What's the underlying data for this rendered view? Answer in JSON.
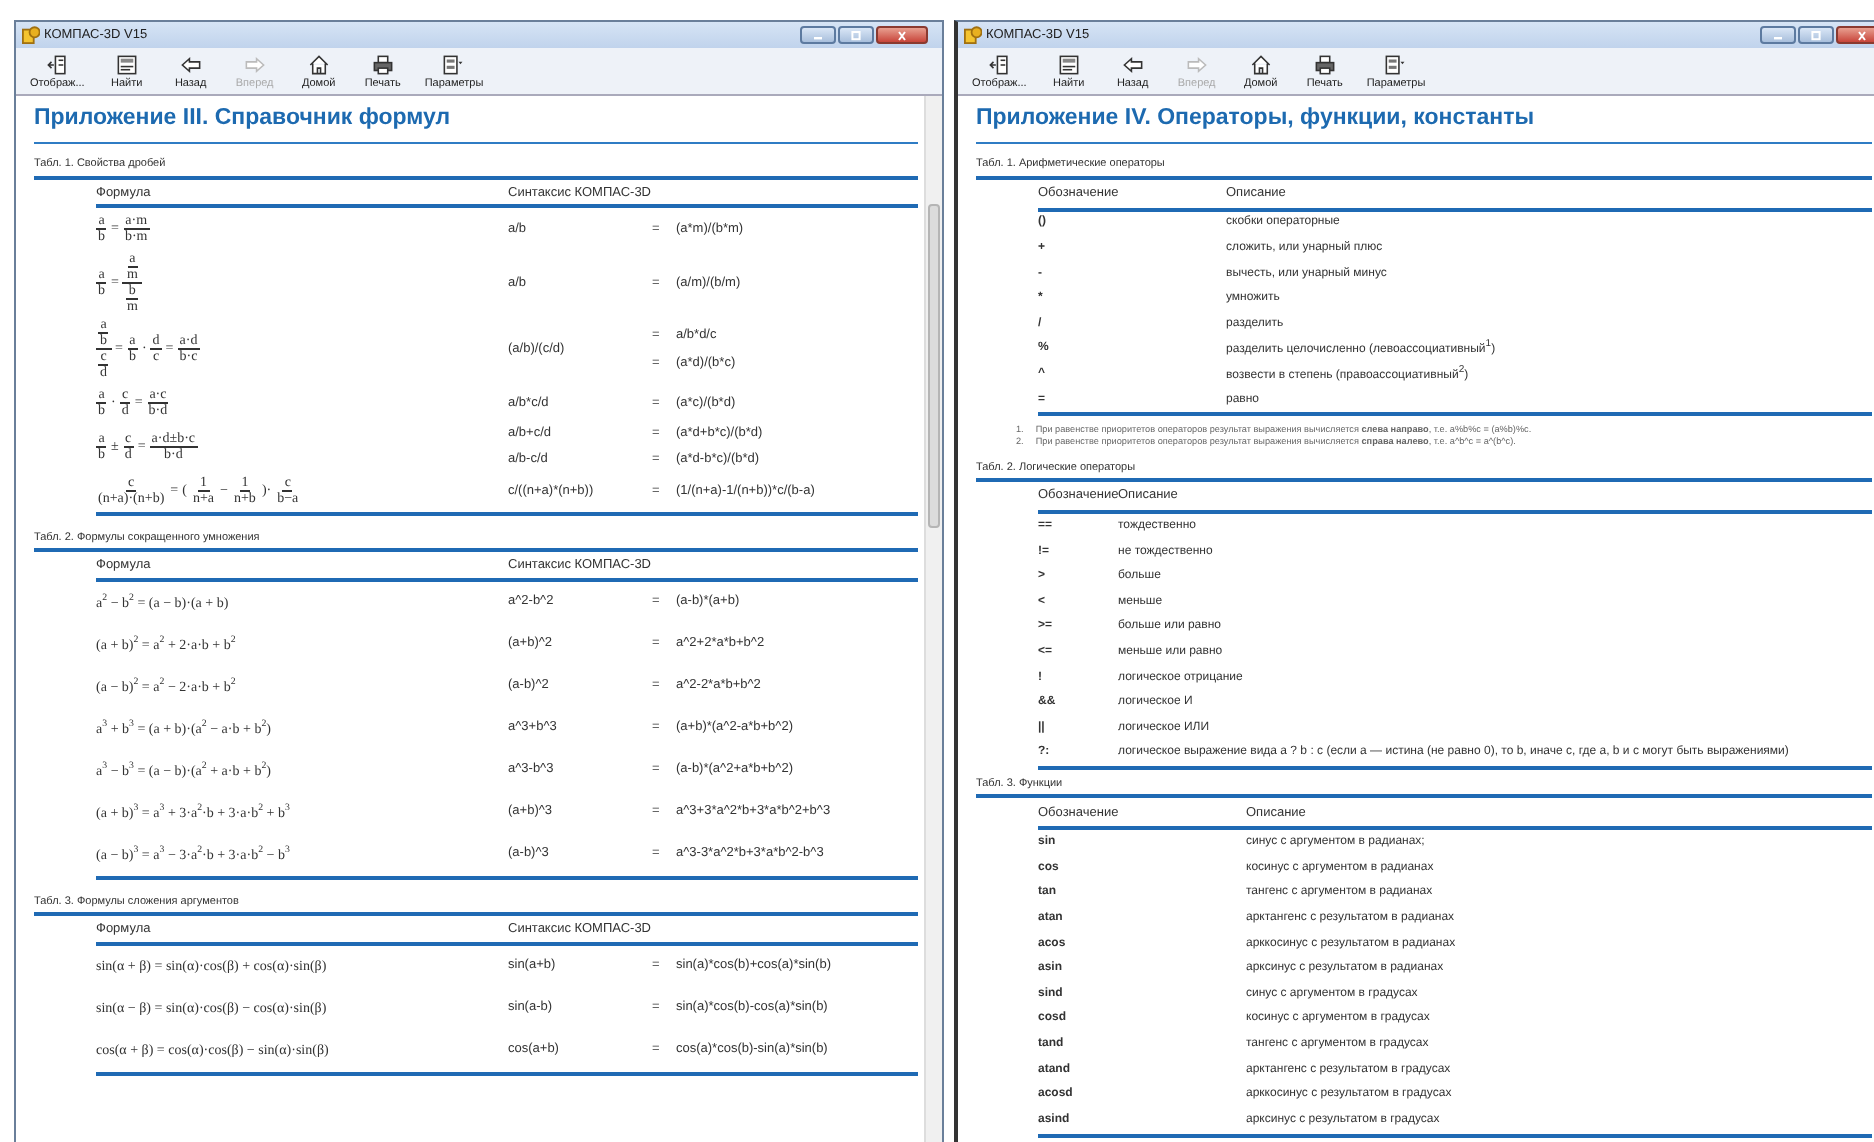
{
  "windows": [
    {
      "title": "КОМПАС-3D V15",
      "toolbar": [
        {
          "label": "Отображ...",
          "disabled": false
        },
        {
          "label": "Найти",
          "disabled": false
        },
        {
          "label": "Назад",
          "disabled": false
        },
        {
          "label": "Вперед",
          "disabled": true
        },
        {
          "label": "Домой",
          "disabled": false
        },
        {
          "label": "Печать",
          "disabled": false
        },
        {
          "label": "Параметры",
          "disabled": false
        }
      ],
      "heading": "Приложение III. Справочник формул",
      "tables": [
        {
          "kind": "formulas",
          "caption": "Табл. 1. Свойства дробей",
          "columns": [
            "Формула",
            "Синтаксис КОМПАС-3D"
          ],
          "rows": [
            {
              "formula": [
                {
                  "kind": "frac",
                  "num": "a",
                  "den": "b"
                },
                {
                  "kind": "text",
                  "text": "="
                },
                {
                  "kind": "frac",
                  "num": "a·m",
                  "den": "b·m"
                }
              ],
              "syntax": [
                "a/b"
              ],
              "results": [
                {
                  "sign": "=",
                  "value": "(a*m)/(b*m)"
                }
              ]
            },
            {
              "formula": [
                {
                  "kind": "frac",
                  "num": "a",
                  "den": "b"
                },
                {
                  "kind": "text",
                  "text": "="
                },
                {
                  "kind": "cfrac",
                  "num": [
                    {
                      "kind": "frac",
                      "num": "a",
                      "den": "m"
                    }
                  ],
                  "den": [
                    {
                      "kind": "frac",
                      "num": "b",
                      "den": "m"
                    }
                  ]
                }
              ],
              "syntax": [
                "a/b"
              ],
              "results": [
                {
                  "sign": "=",
                  "value": "(a/m)/(b/m)"
                }
              ]
            },
            {
              "formula": [
                {
                  "kind": "cfrac",
                  "num": [
                    {
                      "kind": "frac",
                      "num": "a",
                      "den": "b"
                    }
                  ],
                  "den": [
                    {
                      "kind": "frac",
                      "num": "c",
                      "den": "d"
                    }
                  ]
                },
                {
                  "kind": "text",
                  "text": "="
                },
                {
                  "kind": "frac",
                  "num": "a",
                  "den": "b"
                },
                {
                  "kind": "text",
                  "text": "·"
                },
                {
                  "kind": "frac",
                  "num": "d",
                  "den": "c"
                },
                {
                  "kind": "text",
                  "text": "="
                },
                {
                  "kind": "frac",
                  "num": "a·d",
                  "den": "b·c"
                }
              ],
              "syntax": [
                "(a/b)/(c/d)"
              ],
              "results": [
                {
                  "sign": "=",
                  "value": "a/b*d/c"
                },
                {
                  "sign": "=",
                  "value": "(a*d)/(b*c)"
                }
              ]
            },
            {
              "formula": [
                {
                  "kind": "frac",
                  "num": "a",
                  "den": "b"
                },
                {
                  "kind": "text",
                  "text": "·"
                },
                {
                  "kind": "frac",
                  "num": "c",
                  "den": "d"
                },
                {
                  "kind": "text",
                  "text": "="
                },
                {
                  "kind": "frac",
                  "num": "a·c",
                  "den": "b·d"
                }
              ],
              "syntax": [
                "a/b*c/d"
              ],
              "results": [
                {
                  "sign": "=",
                  "value": "(a*c)/(b*d)"
                }
              ]
            },
            {
              "formula": [
                {
                  "kind": "frac",
                  "num": "a",
                  "den": "b"
                },
                {
                  "kind": "text",
                  "text": "±"
                },
                {
                  "kind": "frac",
                  "num": "c",
                  "den": "d"
                },
                {
                  "kind": "text",
                  "text": "="
                },
                {
                  "kind": "frac",
                  "num": "a·d±b·c",
                  "den": "b·d"
                }
              ],
              "syntax": [
                "a/b+c/d",
                "a/b-c/d"
              ],
              "results": [
                {
                  "sign": "=",
                  "value": "(a*d+b*c)/(b*d)"
                },
                {
                  "sign": "=",
                  "value": "(a*d-b*c)/(b*d)"
                }
              ]
            },
            {
              "formula": [
                {
                  "kind": "frac",
                  "num": "c",
                  "den": "(n+a)·(n+b)"
                },
                {
                  "kind": "text",
                  "text": "="
                },
                {
                  "kind": "text",
                  "text": "("
                },
                {
                  "kind": "frac",
                  "num": "1",
                  "den": "n+a"
                },
                {
                  "kind": "text",
                  "text": "−"
                },
                {
                  "kind": "frac",
                  "num": "1",
                  "den": "n+b"
                },
                {
                  "kind": "text",
                  "text": ")·"
                },
                {
                  "kind": "frac",
                  "num": "c",
                  "den": "b−a"
                }
              ],
              "syntax": [
                "c/((n+a)*(n+b))"
              ],
              "results": [
                {
                  "sign": "=",
                  "value": "(1/(n+a)-1/(n+b))*c/(b-a)"
                }
              ]
            }
          ]
        },
        {
          "kind": "formulas",
          "caption": "Табл. 2. Формулы сокращенного умножения",
          "columns": [
            "Формула",
            "Синтаксис КОМПАС-3D"
          ],
          "rows": [
            {
              "formula": [
                {
                  "kind": "text",
                  "text": "a$^{2}$ − b$^{2}$ = (a − b)·(a + b)"
                }
              ],
              "syntax": [
                "a^2-b^2"
              ],
              "results": [
                {
                  "sign": "=",
                  "value": "(a-b)*(a+b)"
                }
              ]
            },
            {
              "formula": [
                {
                  "kind": "text",
                  "text": "(a + b)$^{2}$ = a$^{2}$ + 2·a·b + b$^{2}$"
                }
              ],
              "syntax": [
                "(a+b)^2"
              ],
              "results": [
                {
                  "sign": "=",
                  "value": "a^2+2*a*b+b^2"
                }
              ]
            },
            {
              "formula": [
                {
                  "kind": "text",
                  "text": "(a − b)$^{2}$ = a$^{2}$ − 2·a·b + b$^{2}$"
                }
              ],
              "syntax": [
                "(a-b)^2"
              ],
              "results": [
                {
                  "sign": "=",
                  "value": "a^2-2*a*b+b^2"
                }
              ]
            },
            {
              "formula": [
                {
                  "kind": "text",
                  "text": "a$^{3}$ + b$^{3}$ = (a + b)·(a$^{2}$ − a·b + b$^{2}$)"
                }
              ],
              "syntax": [
                "a^3+b^3"
              ],
              "results": [
                {
                  "sign": "=",
                  "value": "(a+b)*(a^2-a*b+b^2)"
                }
              ]
            },
            {
              "formula": [
                {
                  "kind": "text",
                  "text": "a$^{3}$ − b$^{3}$ = (a − b)·(a$^{2}$ + a·b + b$^{2}$)"
                }
              ],
              "syntax": [
                "a^3-b^3"
              ],
              "results": [
                {
                  "sign": "=",
                  "value": "(a-b)*(a^2+a*b+b^2)"
                }
              ]
            },
            {
              "formula": [
                {
                  "kind": "text",
                  "text": "(a + b)$^{3}$ = a$^{3}$ + 3·a$^{2}$·b + 3·a·b$^{2}$ + b$^{3}$"
                }
              ],
              "syntax": [
                "(a+b)^3"
              ],
              "results": [
                {
                  "sign": "=",
                  "value": "a^3+3*a^2*b+3*a*b^2+b^3"
                }
              ]
            },
            {
              "formula": [
                {
                  "kind": "text",
                  "text": "(a − b)$^{3}$ = a$^{3}$ − 3·a$^{2}$·b + 3·a·b$^{2}$ − b$^{3}$"
                }
              ],
              "syntax": [
                "(a-b)^3"
              ],
              "results": [
                {
                  "sign": "=",
                  "value": "a^3-3*a^2*b+3*a*b^2-b^3"
                }
              ]
            }
          ]
        },
        {
          "kind": "formulas",
          "caption": "Табл. 3. Формулы сложения аргументов",
          "columns": [
            "Формула",
            "Синтаксис КОМПАС-3D"
          ],
          "rows": [
            {
              "formula": [
                {
                  "kind": "text",
                  "text": "sin(α + β) = sin(α)·cos(β) + cos(α)·sin(β)"
                }
              ],
              "syntax": [
                "sin(a+b)"
              ],
              "results": [
                {
                  "sign": "=",
                  "value": "sin(a)*cos(b)+cos(a)*sin(b)"
                }
              ]
            },
            {
              "formula": [
                {
                  "kind": "text",
                  "text": "sin(α − β) = sin(α)·cos(β) − cos(α)·sin(β)"
                }
              ],
              "syntax": [
                "sin(a-b)"
              ],
              "results": [
                {
                  "sign": "=",
                  "value": "sin(a)*cos(b)-cos(a)*sin(b)"
                }
              ]
            },
            {
              "formula": [
                {
                  "kind": "text",
                  "text": "cos(α + β) = cos(α)·cos(β) − sin(α)·sin(β)"
                }
              ],
              "syntax": [
                "cos(a+b)"
              ],
              "results": [
                {
                  "sign": "=",
                  "value": "cos(a)*cos(b)-sin(a)*sin(b)"
                }
              ]
            }
          ]
        }
      ]
    },
    {
      "title": "КОМПАС-3D V15",
      "toolbar": [
        {
          "label": "Отображ...",
          "disabled": false
        },
        {
          "label": "Найти",
          "disabled": false
        },
        {
          "label": "Назад",
          "disabled": false
        },
        {
          "label": "Вперед",
          "disabled": true
        },
        {
          "label": "Домой",
          "disabled": false
        },
        {
          "label": "Печать",
          "disabled": false
        },
        {
          "label": "Параметры",
          "disabled": false
        }
      ],
      "heading": "Приложение IV. Операторы, функции, константы",
      "tables": [
        {
          "kind": "glossary",
          "caption": "Табл. 1. Арифметические операторы",
          "columns": [
            "Обозначение",
            "Описание"
          ],
          "rows": [
            {
              "symbol": "()",
              "description": "скобки операторные"
            },
            {
              "symbol": "+",
              "description": "сложить, или унарный плюс"
            },
            {
              "symbol": "-",
              "description": "вычесть, или унарный минус"
            },
            {
              "symbol": "*",
              "description": "умножить"
            },
            {
              "symbol": "/",
              "description": "разделить"
            },
            {
              "symbol": "%",
              "description": "разделить целочисленно (левоассоциативный$^{1}$)"
            },
            {
              "symbol": "^",
              "description": "возвести в степень (правоассоциативный$^{2}$)"
            },
            {
              "symbol": "=",
              "description": "равно"
            }
          ],
          "footnotes": [
            {
              "number": "1.",
              "text": "При равенстве приоритетов операторов результат выражения вычисляется **слева направо**, т.е. a%b%c = (a%b)%c."
            },
            {
              "number": "2.",
              "text": "При равенстве приоритетов операторов результат выражения вычисляется **справа налево**, т.е. a^b^c = a^(b^c)."
            }
          ]
        },
        {
          "kind": "glossary",
          "caption": "Табл. 2. Логические операторы",
          "columns": [
            "Обозначение",
            "Описание"
          ],
          "rows": [
            {
              "symbol": "==",
              "description": "тождественно"
            },
            {
              "symbol": "!=",
              "description": "не тождественно"
            },
            {
              "symbol": ">",
              "description": "больше"
            },
            {
              "symbol": "<",
              "description": "меньше"
            },
            {
              "symbol": ">=",
              "description": "больше или равно"
            },
            {
              "symbol": "<=",
              "description": "меньше или равно"
            },
            {
              "symbol": "!",
              "description": "логическое отрицание"
            },
            {
              "symbol": "&&",
              "description": "логическое И"
            },
            {
              "symbol": "||",
              "description": "логическое ИЛИ"
            },
            {
              "symbol": "?:",
              "description": "логическое выражение вида a ? b : c (если a — истина (не равно 0), то b, иначе c, где a, b и c могут быть выражениями)"
            }
          ]
        },
        {
          "kind": "glossary",
          "caption": "Табл. 3. Функции",
          "columns": [
            "Обозначение",
            "Описание"
          ],
          "rows": [
            {
              "symbol": "sin",
              "description": "синус с аргументом в радианах;"
            },
            {
              "symbol": "cos",
              "description": "косинус с аргументом в радианах"
            },
            {
              "symbol": "tan",
              "description": "тангенс с аргументом в радианах"
            },
            {
              "symbol": "atan",
              "description": "арктангенс с результатом в радианах"
            },
            {
              "symbol": "acos",
              "description": "арккосинус с результатом в радианах"
            },
            {
              "symbol": "asin",
              "description": "арксинус с результатом в радианах"
            },
            {
              "symbol": "sind",
              "description": "синус с аргументом в градусах"
            },
            {
              "symbol": "cosd",
              "description": "косинус с аргументом в градусах"
            },
            {
              "symbol": "tand",
              "description": "тангенс с аргументом в градусах"
            },
            {
              "symbol": "atand",
              "description": "арктангенс с результатом в градусах"
            },
            {
              "symbol": "acosd",
              "description": "арккосинус с результатом в градусах"
            },
            {
              "symbol": "asind",
              "description": "арксинус с результатом в градусах"
            }
          ]
        }
      ]
    }
  ]
}
